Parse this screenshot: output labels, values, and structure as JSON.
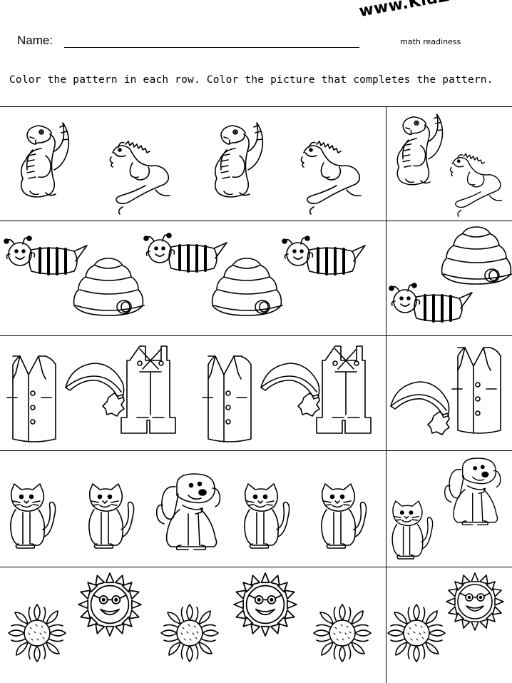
{
  "header": {
    "name_label": "Name:",
    "brand": "www.KidZone.ws",
    "subject": "math readiness"
  },
  "instructions": "Color the pattern in each row.  Color the picture that completes the pattern.",
  "rows": [
    {
      "pattern": [
        "dinosaur",
        "iguana",
        "dinosaur",
        "iguana"
      ],
      "answers": [
        "dinosaur",
        "iguana"
      ]
    },
    {
      "pattern": [
        "bee",
        "beehive",
        "bee",
        "beehive",
        "bee"
      ],
      "answers": [
        "beehive",
        "bee"
      ]
    },
    {
      "pattern": [
        "vest",
        "santa-hat",
        "overalls",
        "vest",
        "santa-hat",
        "overalls"
      ],
      "answers": [
        "santa-hat",
        "vest"
      ]
    },
    {
      "pattern": [
        "cat",
        "cat",
        "dog",
        "cat",
        "cat"
      ],
      "answers": [
        "cat",
        "dog"
      ]
    },
    {
      "pattern": [
        "sunflower",
        "sun",
        "sunflower",
        "sun",
        "sunflower"
      ],
      "answers": [
        "sunflower",
        "sun"
      ]
    }
  ]
}
